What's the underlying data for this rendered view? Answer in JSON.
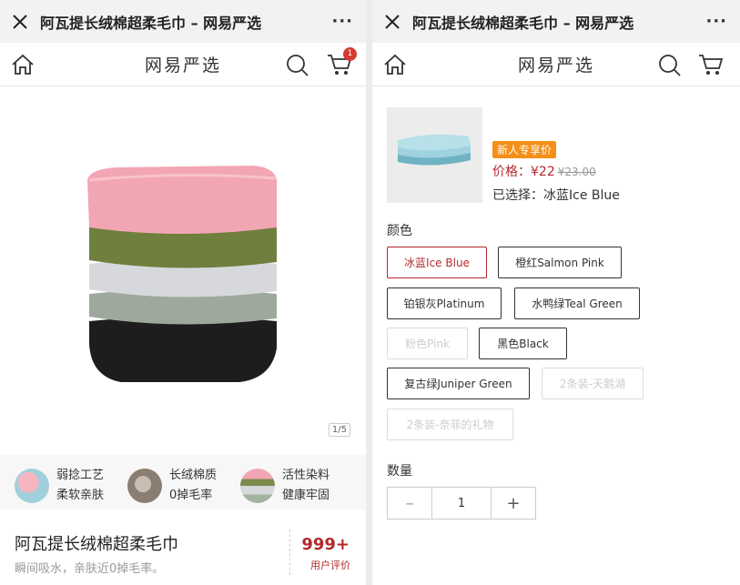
{
  "left": {
    "window_title": "阿瓦提长绒棉超柔毛巾 – 网易严选",
    "brand": "网易严选",
    "cart_badge": "1",
    "gallery_counter": "1/5",
    "features": [
      {
        "line1": "弱捻工艺",
        "line2": "柔软亲肤",
        "icon": "towel-thumb-blue-pink"
      },
      {
        "line1": "长绒棉质",
        "line2": "0掉毛率",
        "icon": "towel-thumb-brown"
      },
      {
        "line1": "活性染料",
        "line2": "健康牢固",
        "icon": "towel-thumb-stack"
      }
    ],
    "product_name": "阿瓦提长绒棉超柔毛巾",
    "product_desc": "瞬间吸水，亲肤近0掉毛率。",
    "review_count": "999+",
    "review_label": "用户评价"
  },
  "right": {
    "window_title": "阿瓦提长绒棉超柔毛巾 – 网易严选",
    "brand": "网易严选",
    "promo_tag": "新人专享价",
    "price_label": "价格：",
    "price": "¥22",
    "old_price": "¥23.00",
    "selected_text": "已选择：冰蓝Ice Blue",
    "color_label": "颜色",
    "colors": [
      {
        "label": "冰蓝Ice Blue",
        "state": "active"
      },
      {
        "label": "橙红Salmon Pink",
        "state": "normal"
      },
      {
        "label": "铂银灰Platinum",
        "state": "normal"
      },
      {
        "label": "水鸭绿Teal Green",
        "state": "normal"
      },
      {
        "label": "粉色Pink",
        "state": "disabled"
      },
      {
        "label": "黑色Black",
        "state": "normal"
      },
      {
        "label": "复古绿Juniper Green",
        "state": "normal"
      },
      {
        "label": "2条装-天鹅湖",
        "state": "disabled"
      },
      {
        "label": "2条装-奈菲的礼物",
        "state": "disabled"
      }
    ],
    "quantity_label": "数量",
    "quantity": "1",
    "minus": "–",
    "plus": "+"
  },
  "colors": {
    "accent": "#b4282d",
    "tag": "#f48f18",
    "badge": "#d33a31"
  }
}
